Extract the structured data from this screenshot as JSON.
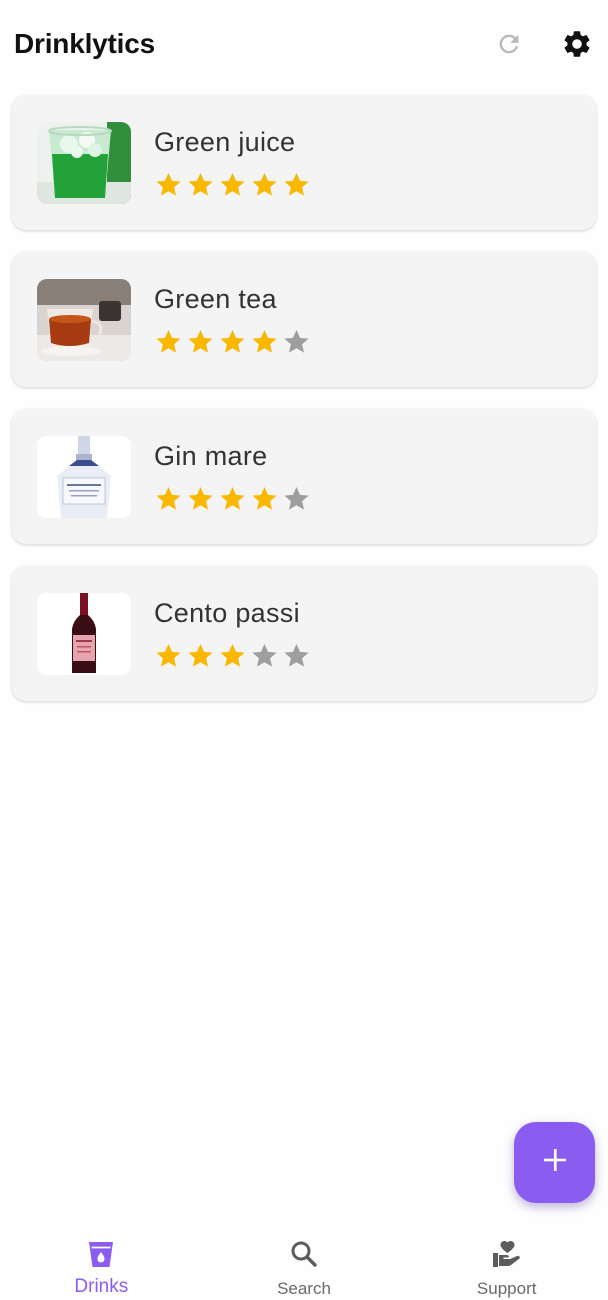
{
  "app": {
    "title": "Drinklytics",
    "refresh_icon": "refresh-icon",
    "settings_icon": "gear-icon"
  },
  "drinks": [
    {
      "name": "Green juice",
      "rating": 5,
      "max_rating": 5,
      "image": "green-juice-glass"
    },
    {
      "name": "Green tea",
      "rating": 4,
      "max_rating": 5,
      "image": "tea-cup"
    },
    {
      "name": "Gin mare",
      "rating": 4,
      "max_rating": 5,
      "image": "gin-bottle"
    },
    {
      "name": "Cento passi",
      "rating": 3,
      "max_rating": 5,
      "image": "wine-bottle"
    }
  ],
  "fab": {
    "icon": "plus-icon"
  },
  "nav": {
    "items": [
      {
        "label": "Drinks",
        "icon": "drink-glass-icon",
        "active": true
      },
      {
        "label": "Search",
        "icon": "search-icon",
        "active": false
      },
      {
        "label": "Support",
        "icon": "hand-heart-icon",
        "active": false
      }
    ]
  },
  "colors": {
    "accent": "#8b5cf0",
    "star_filled": "#f9b700",
    "star_empty": "#9e9e9e",
    "card_bg": "#f4f4f4"
  }
}
